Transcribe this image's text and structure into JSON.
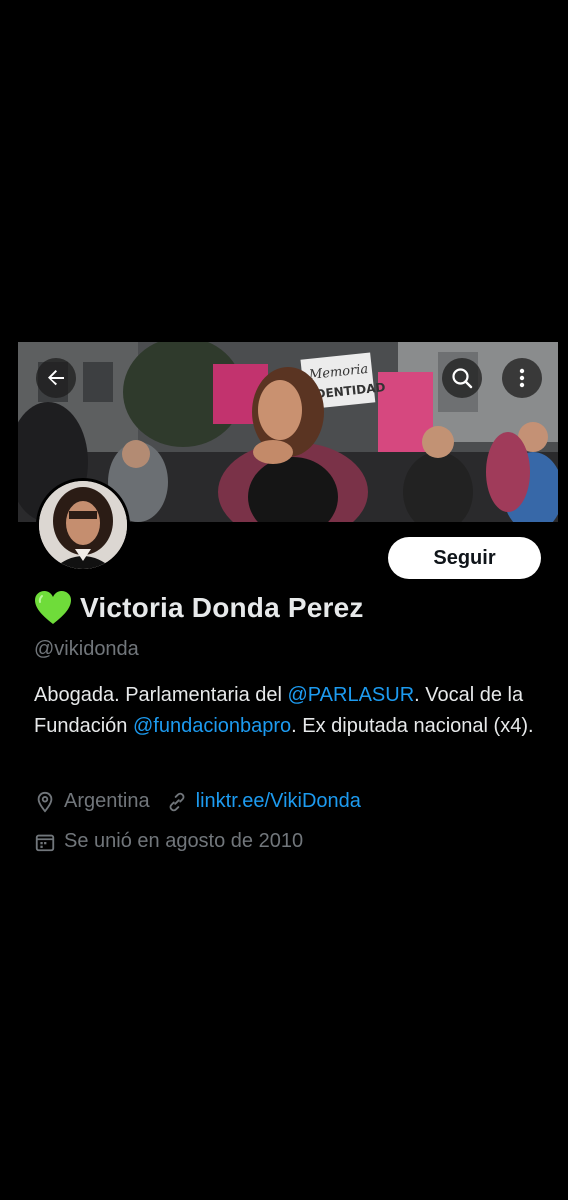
{
  "profile": {
    "display_name": "Victoria Donda Perez",
    "handle": "@vikidonda",
    "follow_label": "Seguir",
    "bio_part1": "Abogada. Parlamentaria del ",
    "bio_mention1": "@PARLASUR",
    "bio_part2": ". Vocal de la Fundación ",
    "bio_mention2": "@fundacionbapro",
    "bio_part3": ". Ex diputada nacional (x4).",
    "location": "Argentina",
    "website": "linktr.ee/VikiDonda",
    "joined": "Se unió en agosto de 2010"
  },
  "banner_sign": {
    "line1": "Memoria",
    "line2": "IDENTIDAD"
  },
  "icons": {
    "back": "arrow-left-icon",
    "search": "search-icon",
    "more": "more-vertical-icon",
    "name_emoji": "green-heart-icon",
    "location": "location-pin-icon",
    "website": "link-icon",
    "joined": "calendar-icon"
  },
  "colors": {
    "background": "#000000",
    "text": "#e7e9ea",
    "secondary": "#71767b",
    "link": "#1d9bf0",
    "heart": "#6fdc3a",
    "follow_bg": "#ffffff"
  }
}
